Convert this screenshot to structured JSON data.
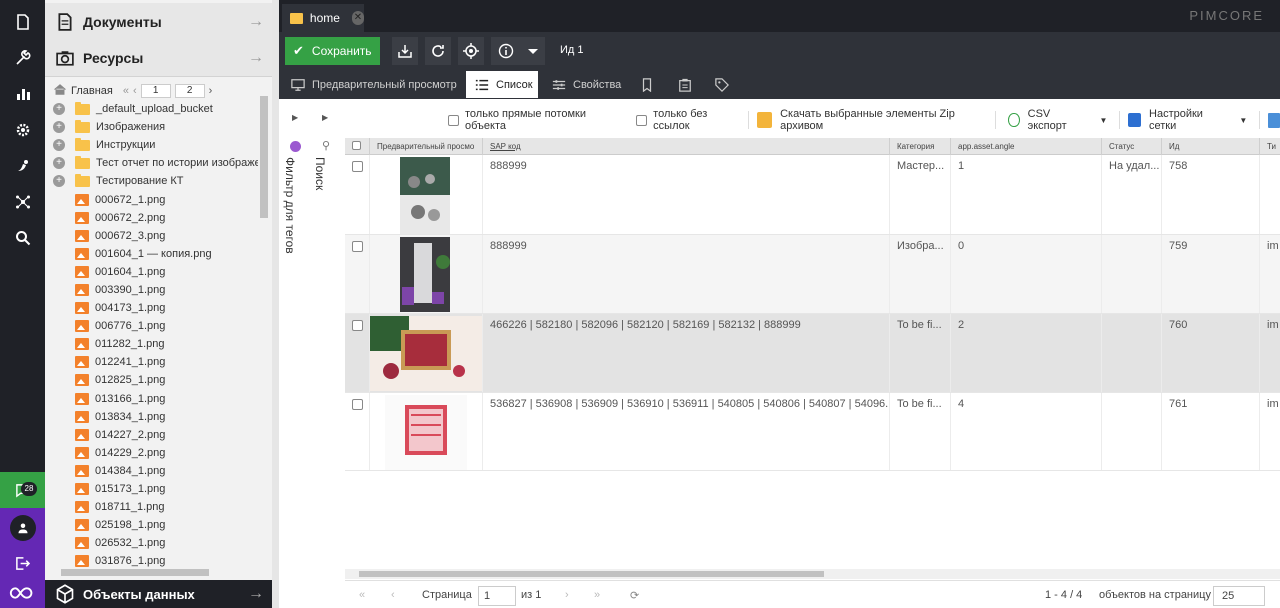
{
  "rail": {
    "icons": [
      "file-icon",
      "wrench-icon",
      "chart-icon",
      "gear-icon",
      "marketing-icon",
      "network-icon",
      "search-icon"
    ],
    "notification_count": "28"
  },
  "tree_panel": {
    "documents_title": "Документы",
    "assets_title": "Ресурсы",
    "objects_title": "Объекты данных",
    "home_label": "Главная",
    "page_input_1": "1",
    "page_input_2": "2",
    "folders": [
      "_default_upload_bucket",
      "Изображения",
      "Инструкции",
      "Тест отчет по истории изображе",
      "Тестирование КТ"
    ],
    "files": [
      "000672_1.png",
      "000672_2.png",
      "000672_3.png",
      "001604_1 — копия.png",
      "001604_1.png",
      "003390_1.png",
      "004173_1.png",
      "006776_1.png",
      "011282_1.png",
      "012241_1.png",
      "012825_1.png",
      "013166_1.png",
      "013834_1.png",
      "014227_2.png",
      "014229_2.png",
      "014384_1.png",
      "015173_1.png",
      "018711_1.png",
      "025198_1.png",
      "026532_1.png",
      "031876_1.png"
    ]
  },
  "tabbar": {
    "home_tab": "home",
    "brand": "PIMCORE"
  },
  "actions": {
    "save_label": "Сохранить",
    "id_label": "Ид 1"
  },
  "subtabs": {
    "preview": "Предварительный просмотр",
    "list": "Список",
    "properties": "Свойства"
  },
  "side": {
    "tag_filter": "Фильтр для тегов",
    "search": "Поиск"
  },
  "grid_toolbar": {
    "direct_children": "только прямые потомки объекта",
    "unreferenced": "только без ссылок",
    "download_zip": "Скачать выбранные элементы Zip архивом",
    "csv_export": "CSV экспорт",
    "grid_settings": "Настройки сетки"
  },
  "grid": {
    "columns": [
      "Предварительный просмо",
      "SAP код",
      "Категория",
      "app.asset.angle",
      "Статус",
      "Ид",
      "Ти"
    ],
    "rows": [
      {
        "sap": "888999",
        "category": "Мастер...",
        "angle": "1",
        "status": "На удал...",
        "id": "758",
        "type": ""
      },
      {
        "sap": "888999",
        "category": "Изобра...",
        "angle": "0",
        "status": "",
        "id": "759",
        "type": "im"
      },
      {
        "sap": "466226 | 582180 | 582096 | 582120 | 582169 | 582132 | 888999",
        "category": "To be fi...",
        "angle": "2",
        "status": "",
        "id": "760",
        "type": "im"
      },
      {
        "sap": "536827 | 536908 | 536909 | 536910 | 536911 | 540805 | 540806 | 540807 | 54096...",
        "category": "To be fi...",
        "angle": "4",
        "status": "",
        "id": "761",
        "type": "im"
      }
    ]
  },
  "paging": {
    "page_label": "Страница",
    "page_value": "1",
    "of_label": "из 1",
    "range": "1 - 4 / 4",
    "per_page_label": "объектов на страницу",
    "per_page_value": "25"
  },
  "colors": {
    "rail_bg": "#1f2127",
    "save_green": "#35a145",
    "user_purple": "#6428b4",
    "folder_yellow": "#f8c24a",
    "image_orange": "#f3812b"
  }
}
